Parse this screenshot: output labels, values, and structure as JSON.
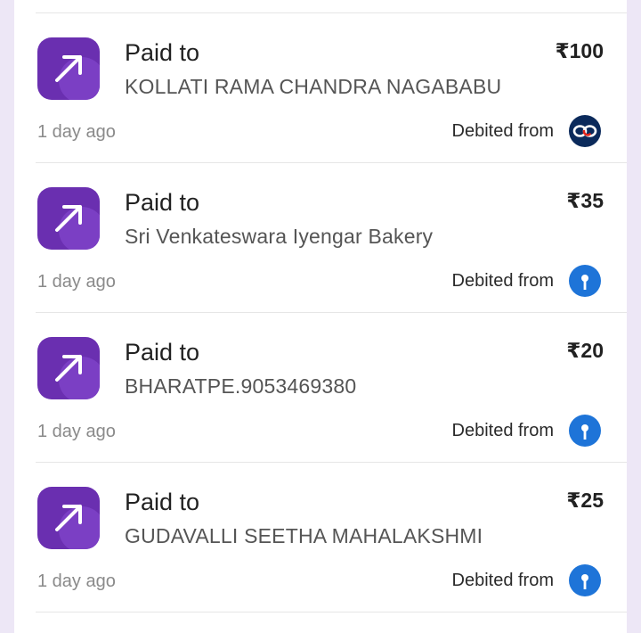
{
  "transactions": [
    {
      "label": "Paid to",
      "payee": "KOLLATI RAMA CHANDRA NAGABABU",
      "amount": "₹100",
      "time": "1 day ago",
      "debited_label": "Debited from",
      "bank_icon": "kotak-bank-icon"
    },
    {
      "label": "Paid to",
      "payee": "Sri Venkateswara Iyengar Bakery",
      "amount": "₹35",
      "time": "1 day ago",
      "debited_label": "Debited from",
      "bank_icon": "sbi-bank-icon"
    },
    {
      "label": "Paid to",
      "payee": "BHARATPE.9053469380",
      "amount": "₹20",
      "time": "1 day ago",
      "debited_label": "Debited from",
      "bank_icon": "sbi-bank-icon"
    },
    {
      "label": "Paid to",
      "payee": "GUDAVALLI SEETHA MAHALAKSHMI",
      "amount": "₹25",
      "time": "1 day ago",
      "debited_label": "Debited from",
      "bank_icon": "sbi-bank-icon"
    }
  ],
  "colors": {
    "background": "#ede7f6",
    "card": "#ffffff",
    "icon_purple": "#6a2fb0",
    "sbi_blue": "#1e74d8",
    "kotak_navy": "#0b2a5b",
    "kotak_red": "#e2231a"
  }
}
